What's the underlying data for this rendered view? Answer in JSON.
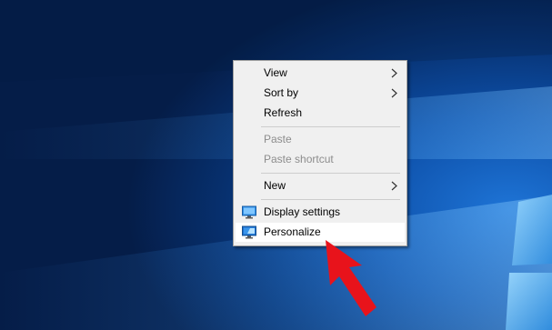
{
  "menu": {
    "items": [
      {
        "label": "View",
        "submenu": true,
        "enabled": true
      },
      {
        "label": "Sort by",
        "submenu": true,
        "enabled": true
      },
      {
        "label": "Refresh",
        "submenu": false,
        "enabled": true
      },
      {
        "label": "Paste",
        "submenu": false,
        "enabled": false
      },
      {
        "label": "Paste shortcut",
        "submenu": false,
        "enabled": false
      },
      {
        "label": "New",
        "submenu": true,
        "enabled": true
      },
      {
        "label": "Display settings",
        "submenu": false,
        "enabled": true,
        "icon": "display-settings-icon"
      },
      {
        "label": "Personalize",
        "submenu": false,
        "enabled": true,
        "icon": "personalize-icon",
        "highlighted": true
      }
    ]
  },
  "annotation": {
    "arrow_color": "#e8131b"
  },
  "colors": {
    "desktop_accent": "#0d4fa8",
    "menu_background": "#f0f0f0",
    "disabled_text": "#8d8d8d"
  }
}
